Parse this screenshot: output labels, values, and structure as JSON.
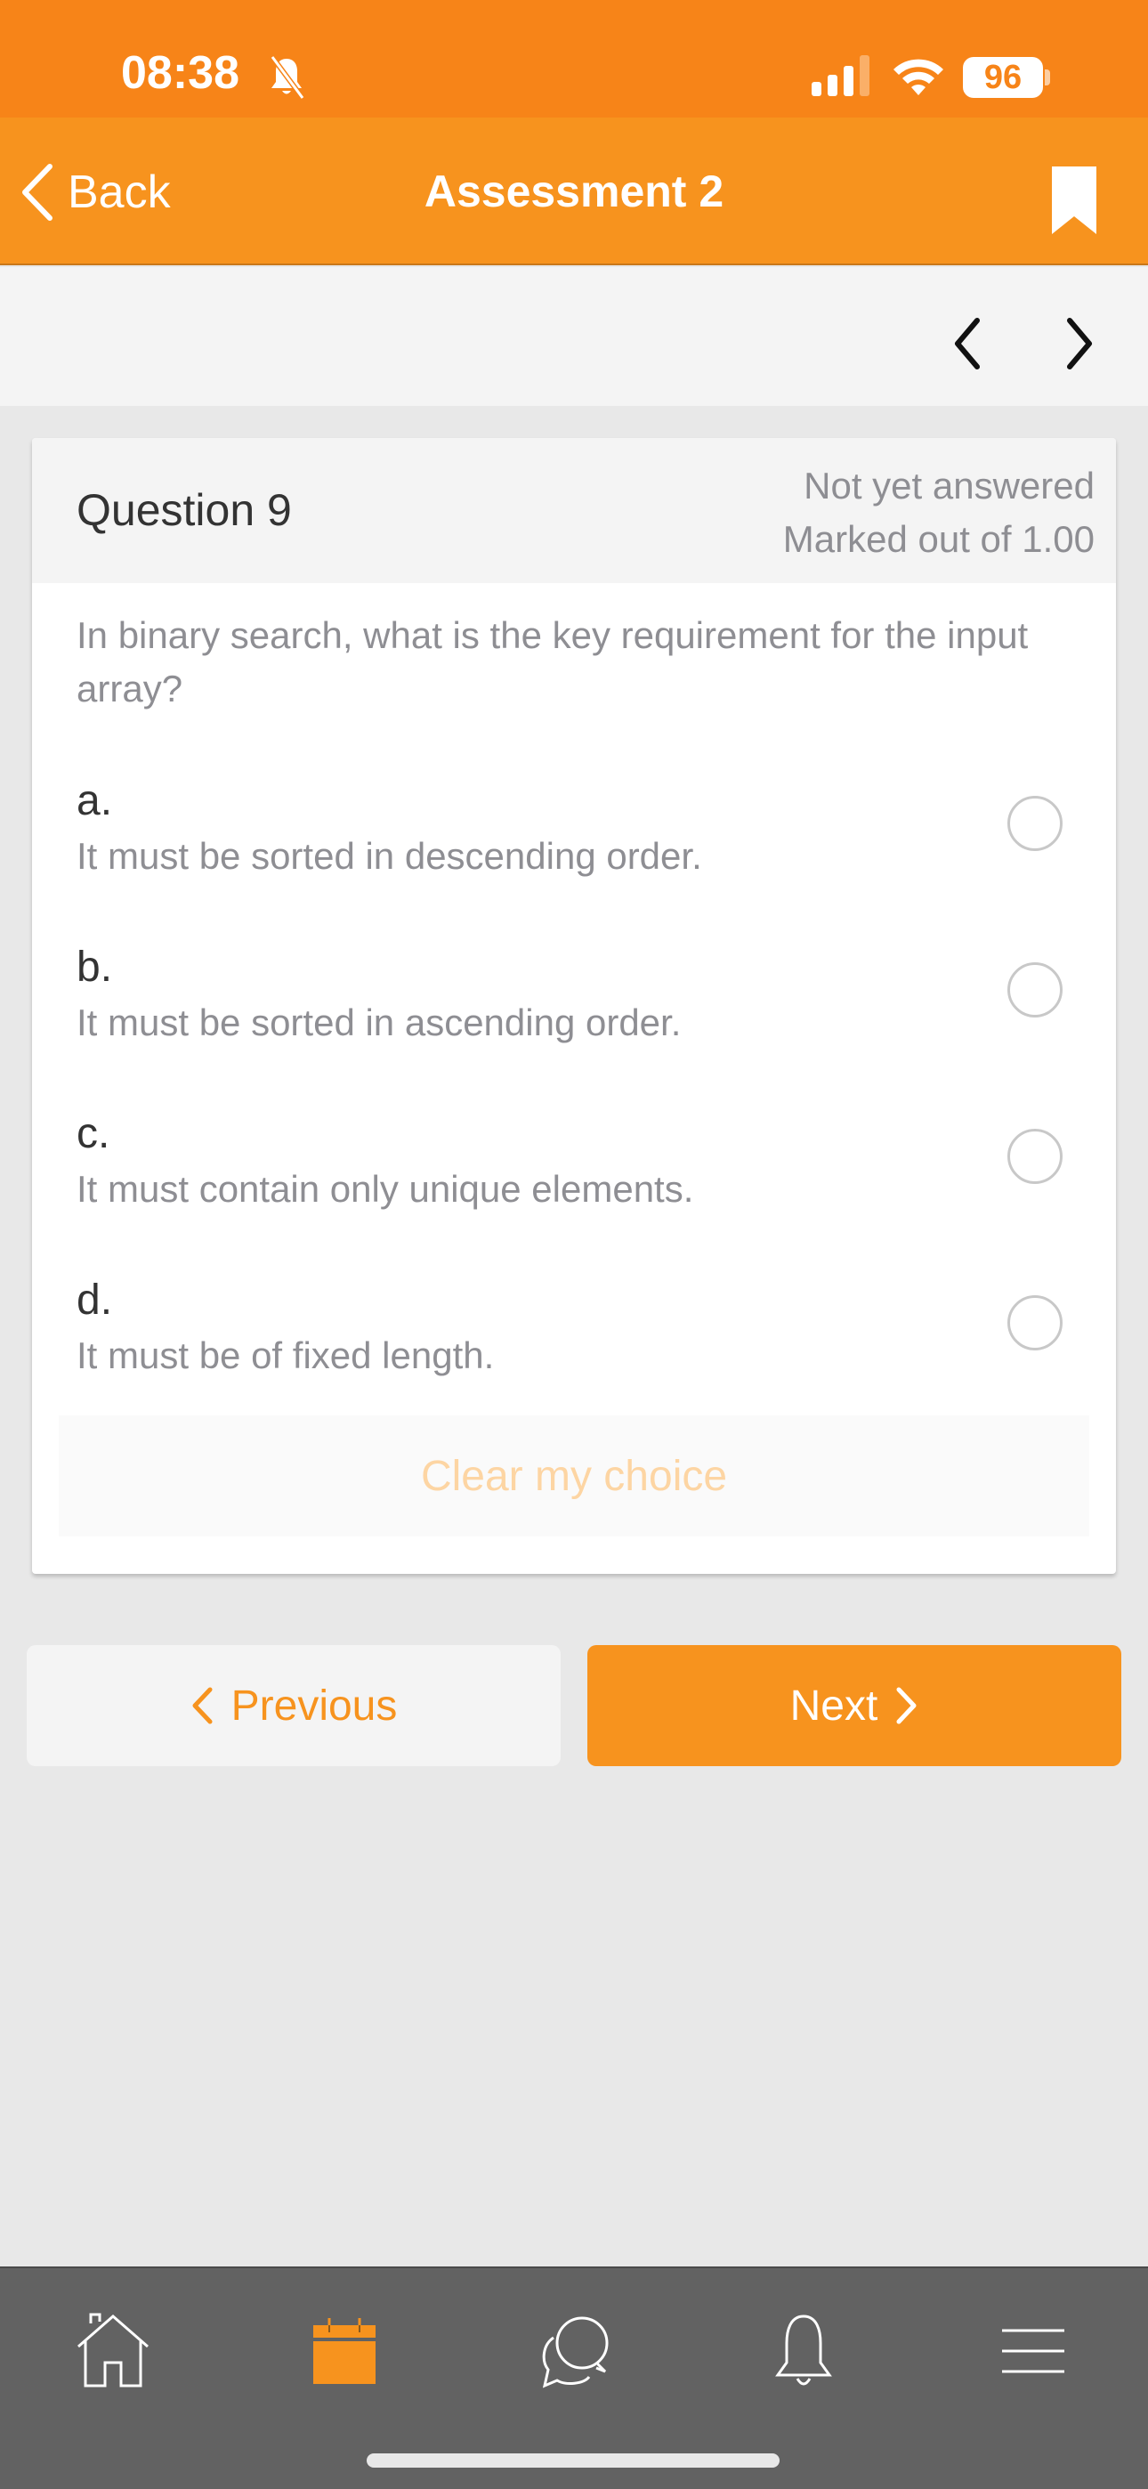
{
  "status_bar": {
    "time": "08:38",
    "battery": "96",
    "icons": [
      "bell-slash-icon",
      "cellular-signal-icon",
      "wifi-icon",
      "battery-icon"
    ]
  },
  "navbar": {
    "back_label": "Back",
    "title": "Assessment 2",
    "bookmark_icon": "bookmark-icon"
  },
  "question": {
    "title": "Question 9",
    "status": "Not yet answered",
    "marks": "Marked out of 1.00",
    "text": "In binary search, what is the key requirement for the input array?",
    "options": [
      {
        "letter": "a.",
        "text": "It must be sorted in descending order.",
        "selected": false
      },
      {
        "letter": "b.",
        "text": "It must be sorted in ascending order.",
        "selected": false
      },
      {
        "letter": "c.",
        "text": "It must contain only unique elements.",
        "selected": false
      },
      {
        "letter": "d.",
        "text": "It must be of fixed length.",
        "selected": false
      }
    ],
    "clear_label": "Clear my choice"
  },
  "navigation": {
    "previous_label": "Previous",
    "next_label": "Next"
  },
  "tabbar": {
    "items": [
      {
        "name": "home",
        "icon": "home-icon",
        "active": false
      },
      {
        "name": "calendar",
        "icon": "calendar-icon",
        "active": true
      },
      {
        "name": "messages",
        "icon": "chat-bubbles-icon",
        "active": false
      },
      {
        "name": "notifications",
        "icon": "bell-icon",
        "active": false
      },
      {
        "name": "more",
        "icon": "hamburger-menu-icon",
        "active": false
      }
    ]
  },
  "colors": {
    "status_bar": "#f78418",
    "accent": "#f7931e",
    "clear_text": "#fdd5a3",
    "tabbar": "#626262",
    "background": "#e8e8e8"
  }
}
